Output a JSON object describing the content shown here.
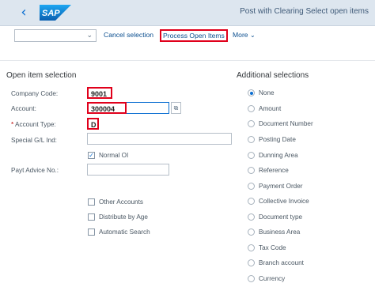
{
  "shell": {
    "back_icon": "chevron-left-icon",
    "logo_text": "SAP",
    "title": "Post with Clearing Select open items"
  },
  "toolbar": {
    "select_value": "",
    "cancel_label": "Cancel selection",
    "process_label": "Process Open Items",
    "more_label": "More"
  },
  "open_item_selection": {
    "heading": "Open item selection",
    "company_code": {
      "label": "Company Code:",
      "value": "9001"
    },
    "account": {
      "label": "Account:",
      "value": "300004"
    },
    "account_type": {
      "label": "Account Type:",
      "required_mark": "*",
      "value": "D"
    },
    "special_gl": {
      "label": "Special G/L Ind:",
      "value": ""
    },
    "normal_oi": {
      "label": "Normal OI",
      "checked": true
    },
    "payt_advice": {
      "label": "Payt Advice No.:",
      "value": ""
    },
    "other_accounts": {
      "label": "Other Accounts",
      "checked": false
    },
    "distribute_by_age": {
      "label": "Distribute by Age",
      "checked": false
    },
    "automatic_search": {
      "label": "Automatic Search",
      "checked": false
    }
  },
  "additional_selections": {
    "heading": "Additional selections",
    "options": [
      {
        "label": "None",
        "selected": true
      },
      {
        "label": "Amount",
        "selected": false
      },
      {
        "label": "Document Number",
        "selected": false
      },
      {
        "label": "Posting Date",
        "selected": false
      },
      {
        "label": "Dunning Area",
        "selected": false
      },
      {
        "label": "Reference",
        "selected": false
      },
      {
        "label": "Payment Order",
        "selected": false
      },
      {
        "label": "Collective Invoice",
        "selected": false
      },
      {
        "label": "Document type",
        "selected": false
      },
      {
        "label": "Business Area",
        "selected": false
      },
      {
        "label": "Tax Code",
        "selected": false
      },
      {
        "label": "Branch account",
        "selected": false
      },
      {
        "label": "Currency",
        "selected": false
      }
    ]
  },
  "colors": {
    "accent": "#0a6ed1",
    "highlight_box": "#e0001b",
    "shell_bg": "#dde6ef"
  }
}
